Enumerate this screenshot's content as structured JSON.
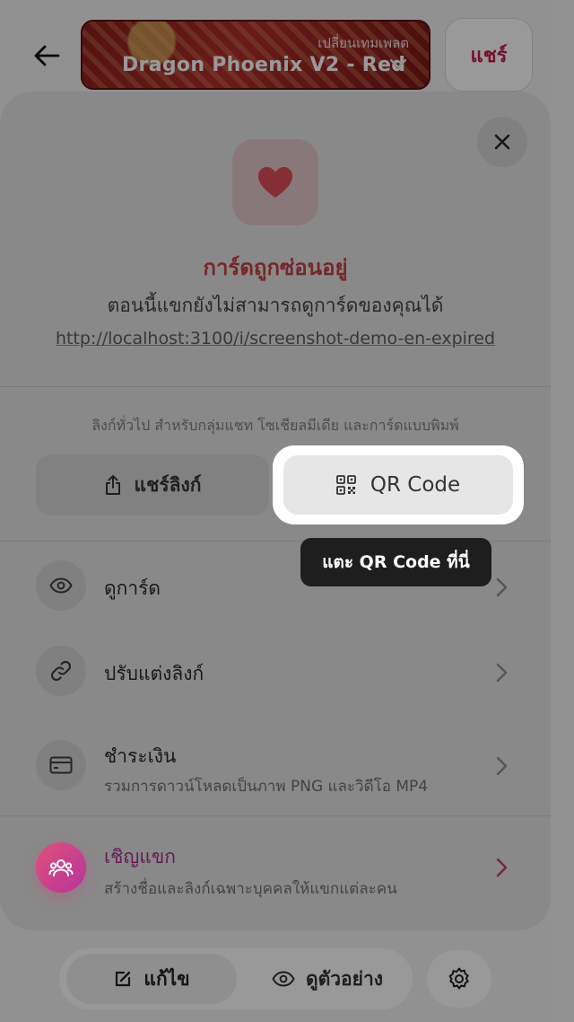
{
  "header": {
    "template_caption": "เปลี่ยนเทมเพลต",
    "template_name": "Dragon Phoenix V2 - Red",
    "share_label": "แชร์"
  },
  "sheet": {
    "status_title": "การ์ดถูกซ่อนอยู่",
    "status_message": "ตอนนี้แขกยังไม่สามารถดูการ์ดของคุณได้",
    "link_url": "http://localhost:3100/i/screenshot-demo-en-expired",
    "share_caption": "ลิงก์ทั่วไป สำหรับกลุ่มแชท โซเชียลมีเดีย และการ์ดแบบพิมพ์",
    "share_link_label": "แชร์ลิงก์",
    "qr_label": "QR Code",
    "tooltip": "แตะ QR Code ที่นี่",
    "rows": [
      {
        "title": "ดูการ์ด",
        "icon": "eye-icon"
      },
      {
        "title": "ปรับแต่งลิงก์",
        "icon": "link-icon"
      },
      {
        "title": "ชำระเงิน",
        "subtitle": "รวมการดาวน์โหลดเป็นภาพ PNG และวิดีโอ MP4",
        "icon": "credit-card-icon"
      },
      {
        "title": "เชิญแขก",
        "subtitle": "สร้างชื่อและลิงก์เฉพาะบุคคลให้แขกแต่ละคน",
        "icon": "users-icon"
      }
    ]
  },
  "bottom_bar": {
    "edit_label": "แก้ไข",
    "preview_label": "ดูตัวอย่าง"
  },
  "colors": {
    "accent": "#c21d4b",
    "status_red": "#d6454d",
    "invite_purple": "#b6349c"
  }
}
